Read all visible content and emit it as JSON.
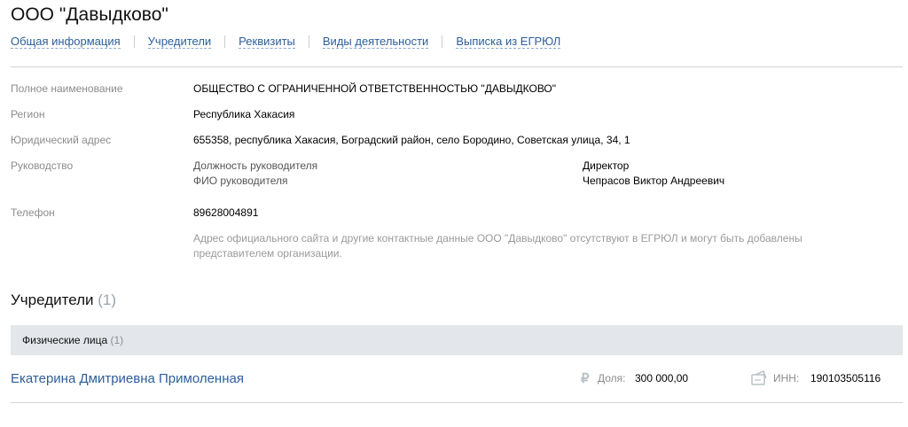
{
  "header": {
    "title": "ООО \"Давыдково\"",
    "tabs": [
      {
        "label": "Общая информация"
      },
      {
        "label": "Учредители"
      },
      {
        "label": "Реквизиты"
      },
      {
        "label": "Виды деятельности"
      },
      {
        "label": "Выписка из ЕГРЮЛ"
      }
    ]
  },
  "info": {
    "full_name": {
      "label": "Полное наименование",
      "value": "ОБЩЕСТВО С ОГРАНИЧЕННОЙ ОТВЕТСТВЕННОСТЬЮ \"ДАВЫДКОВО\""
    },
    "region": {
      "label": "Регион",
      "value": "Республика Хакасия"
    },
    "address": {
      "label": "Юридический адрес",
      "value": "655358, республика Хакасия, Боградский район, село Бородино, Советская улица, 34, 1"
    },
    "management": {
      "label": "Руководство",
      "position_label": "Должность руководителя",
      "position_value": "Директор",
      "name_label": "ФИО руководителя",
      "name_value": "Чепрасов Виктор Андреевич"
    },
    "phone": {
      "label": "Телефон",
      "value": "89628004891"
    },
    "note": "Адрес официального сайта и другие контактные данные ООО \"Давыдково\" отсутствуют в ЕГРЮЛ и могут быть добавлены представителем организации."
  },
  "founders": {
    "title": "Учредители",
    "count": "(1)",
    "group": {
      "label": "Физические лица",
      "count": "(1)"
    },
    "items": [
      {
        "name": "Екатерина Дмитриевна Примоленная",
        "share_label": "Доля:",
        "share_value": "300 000,00",
        "inn_label": "ИНН:",
        "inn_value": "190103505116",
        "share_icon": "ruble-icon",
        "inn_icon": "id-card-icon"
      }
    ]
  },
  "colors": {
    "link": "#2d5e9a",
    "label": "#8c8c8c",
    "group_bg": "#e3e7eb"
  }
}
